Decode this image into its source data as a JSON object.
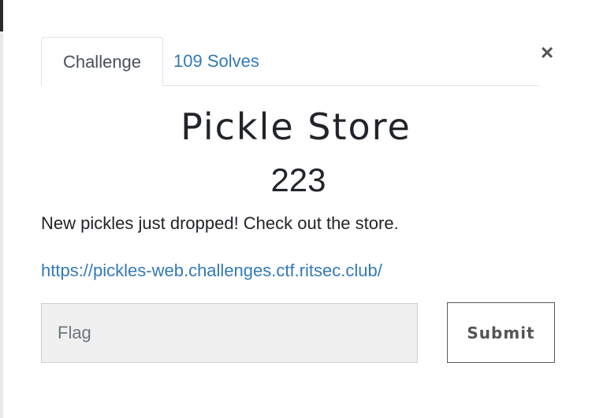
{
  "modal": {
    "close_symbol": "×",
    "tabs": [
      {
        "label": "Challenge",
        "active": true
      },
      {
        "label": "109 Solves",
        "active": false
      }
    ],
    "challenge": {
      "name": "Pickle Store",
      "value": "223",
      "description": "New pickles just dropped! Check out the store.",
      "link": "https://pickles-web.challenges.ctf.ritsec.club/"
    },
    "form": {
      "flag_placeholder": "Flag",
      "flag_value": "",
      "submit_label": "Submit"
    }
  },
  "colors": {
    "link": "#337ab7",
    "text": "#212529",
    "input_bg": "#f0f0f0"
  }
}
